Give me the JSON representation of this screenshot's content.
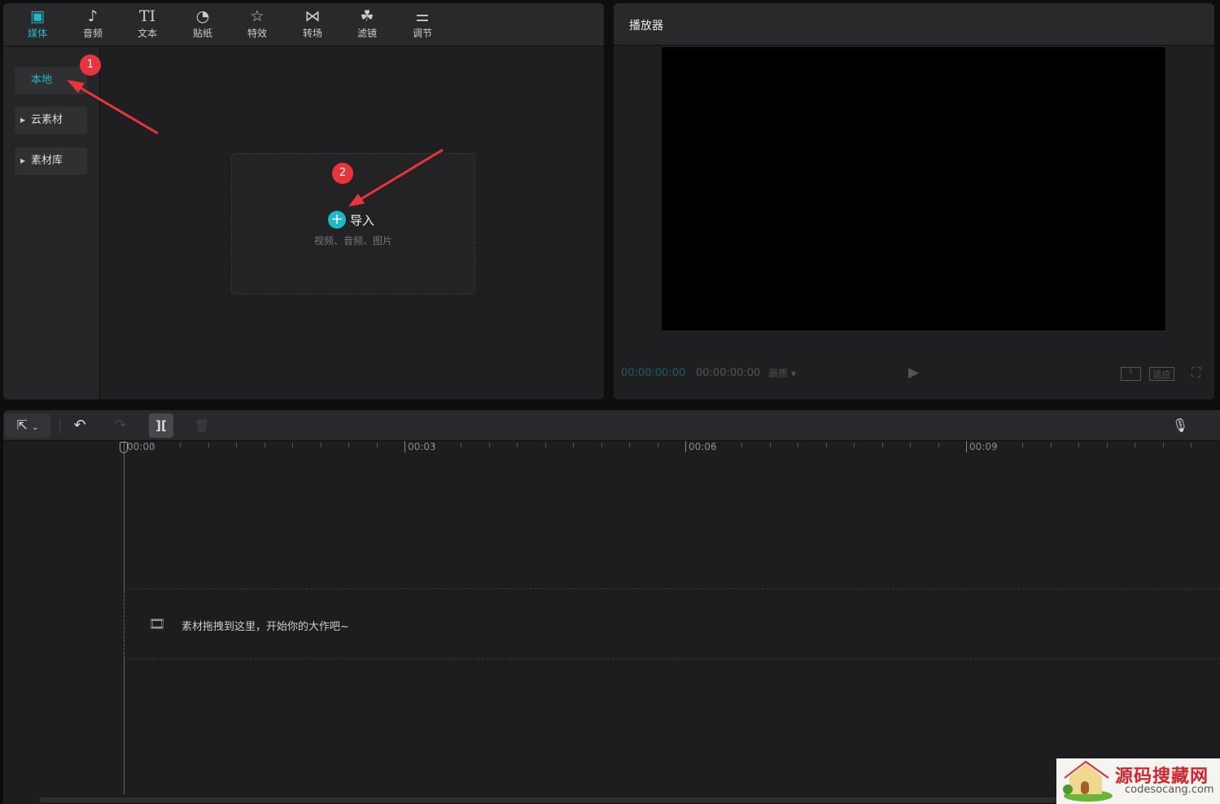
{
  "media_tabs": [
    {
      "label": "媒体",
      "icon": "media-icon"
    },
    {
      "label": "音频",
      "icon": "audio-icon"
    },
    {
      "label": "文本",
      "icon": "text-icon"
    },
    {
      "label": "贴纸",
      "icon": "sticker-icon"
    },
    {
      "label": "特效",
      "icon": "effects-icon"
    },
    {
      "label": "转场",
      "icon": "transition-icon"
    },
    {
      "label": "滤镜",
      "icon": "filter-icon"
    },
    {
      "label": "调节",
      "icon": "adjust-icon"
    }
  ],
  "text_icon_glyph": "TI",
  "sidebar": {
    "items": [
      {
        "label": "本地"
      },
      {
        "label": "云素材"
      },
      {
        "label": "素材库"
      }
    ]
  },
  "import": {
    "label": "导入",
    "hint": "视频、音频、图片"
  },
  "annotations": {
    "badge1": "1",
    "badge2": "2"
  },
  "player": {
    "title": "播放器",
    "current_time": "00:00:00:00",
    "total_time": "00:00:00:00",
    "quality_label": "画质",
    "fit_label": "适应"
  },
  "timeline": {
    "ruler": [
      "00:00",
      "00:03",
      "00:06",
      "00:09"
    ],
    "drop_hint": "素材拖拽到这里，开始你的大作吧~"
  },
  "watermark": {
    "title": "源码搜藏网",
    "url": "codesocang.com"
  },
  "colors": {
    "accent": "#1fb8c6",
    "badge": "#e8353b"
  }
}
